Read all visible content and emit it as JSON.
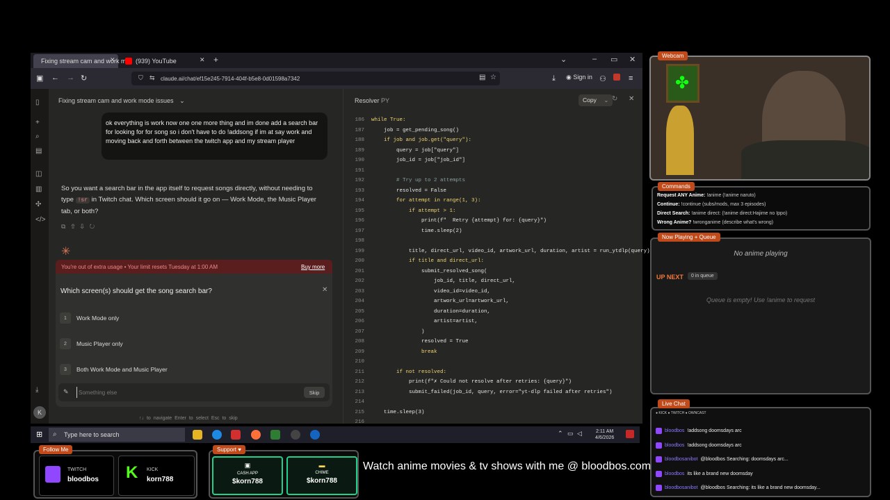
{
  "browser": {
    "tabs": [
      {
        "label": "Fixing stream cam and work m"
      },
      {
        "label": "(939) YouTube"
      }
    ],
    "url": "claude.ai/chat/ef15e245-7914-404f-b5e8-0d01598a7342",
    "signin_label": "Sign in"
  },
  "chat": {
    "title": "Fixing stream cam and work mode issues",
    "user_message": "ok everything is work now one one more thing and im done add a search bar for looking for for song so i don't have to do !addsong if im at say work and moving back and forth between the twitch app and my stream player",
    "assistant_pre": "So you want a search bar in the app itself to request songs directly, without needing to type",
    "assistant_code": "!sr",
    "assistant_post": "in Twitch chat. Which screen should it go on — Work Mode, the Music Player tab, or both?",
    "limit_text": "You're out of extra usage • Your limit resets Tuesday at 1:00 AM",
    "buy_more": "Buy more",
    "question": "Which screen(s) should get the song search bar?",
    "options": [
      {
        "num": "1",
        "label": "Work Mode only"
      },
      {
        "num": "2",
        "label": "Music Player only"
      },
      {
        "num": "3",
        "label": "Both Work Mode and Music Player"
      }
    ],
    "other_placeholder": "Something else",
    "skip": "Skip",
    "hints": "↑↓ to navigate   Enter to select   Esc to skip"
  },
  "code": {
    "title": "Resolver",
    "lang": "PY",
    "copy": "Copy",
    "lines": [
      {
        "n": "186",
        "t": "while True:"
      },
      {
        "n": "187",
        "t": "    job = get_pending_song()"
      },
      {
        "n": "188",
        "t": "    if job and job.get(\"query\"):"
      },
      {
        "n": "189",
        "t": "        query = job[\"query\"]"
      },
      {
        "n": "190",
        "t": "        job_id = job[\"job_id\"]"
      },
      {
        "n": "191",
        "t": ""
      },
      {
        "n": "192",
        "t": "        # Try up to 2 attempts"
      },
      {
        "n": "193",
        "t": "        resolved = False"
      },
      {
        "n": "194",
        "t": "        for attempt in range(1, 3):"
      },
      {
        "n": "195",
        "t": "            if attempt > 1:"
      },
      {
        "n": "196",
        "t": "                print(f\"  Retry {attempt} for: {query}\")"
      },
      {
        "n": "197",
        "t": "                time.sleep(2)"
      },
      {
        "n": "198",
        "t": ""
      },
      {
        "n": "199",
        "t": "            title, direct_url, video_id, artwork_url, duration, artist = run_ytdlp(query)"
      },
      {
        "n": "200",
        "t": "            if title and direct_url:"
      },
      {
        "n": "201",
        "t": "                submit_resolved_song("
      },
      {
        "n": "202",
        "t": "                    job_id, title, direct_url,"
      },
      {
        "n": "203",
        "t": "                    video_id=video_id,"
      },
      {
        "n": "204",
        "t": "                    artwork_url=artwork_url,"
      },
      {
        "n": "205",
        "t": "                    duration=duration,"
      },
      {
        "n": "206",
        "t": "                    artist=artist,"
      },
      {
        "n": "207",
        "t": "                )"
      },
      {
        "n": "208",
        "t": "                resolved = True"
      },
      {
        "n": "209",
        "t": "                break"
      },
      {
        "n": "210",
        "t": ""
      },
      {
        "n": "211",
        "t": "        if not resolved:"
      },
      {
        "n": "212",
        "t": "            print(f\"✗ Could not resolve after retries: {query}\")"
      },
      {
        "n": "213",
        "t": "            submit_failed(job_id, query, error=\"yt-dlp failed after retries\")"
      },
      {
        "n": "214",
        "t": ""
      },
      {
        "n": "215",
        "t": "    time.sleep(3)"
      },
      {
        "n": "216",
        "t": ""
      }
    ]
  },
  "taskbar": {
    "search_placeholder": "Type here to search",
    "time": "2:11 AM",
    "date": "4/6/2026"
  },
  "overlay": {
    "webcam_tag": "Webcam",
    "commands_tag": "Commands",
    "commands": [
      {
        "label": "Request ANY Anime:",
        "cmd": "!anime",
        "desc": "(!anime naruto)"
      },
      {
        "label": "Continue:",
        "cmd": "!continue",
        "desc": "(subs/mods, max 3 episodes)"
      },
      {
        "label": "Direct Search:",
        "cmd": "!anime direct:",
        "desc": "(!anime direct:Hajime no Ippo)"
      },
      {
        "label": "Wrong Anime?",
        "cmd": "!wronganime",
        "desc": "(describe what's wrong)"
      }
    ],
    "now_playing_tag": "Now Playing + Queue",
    "no_anime": "No anime playing",
    "up_next": "UP NEXT",
    "queue_count": "0 in queue",
    "queue_empty": "Queue is empty! Use !anime to request",
    "live_chat_tag": "Live Chat",
    "platforms": "● KICK  ● TWITCH  ● OWNCAST",
    "chat": [
      {
        "user": "bloodbos",
        "msg": "!addsong doomsdays arc"
      },
      {
        "user": "bloodbos",
        "msg": "!addsong doomsdays arc"
      },
      {
        "user": "bloodbosanibot",
        "msg": "@bloodbos Searching: doomsdays arc..."
      },
      {
        "user": "bloodbos",
        "msg": "its like a brand new doomsday"
      },
      {
        "user": "bloodbosanibot",
        "msg": "@bloodbos Searching: its like a brand new doomsday..."
      }
    ],
    "follow_tag": "Follow Me",
    "twitch_label": "TWITCH",
    "twitch_user": "bloodbos",
    "kick_label": "KICK",
    "kick_user": "korn788",
    "support_tag": "Support ♥",
    "cashapp_label": "CASH APP",
    "cashapp_user": "$korn788",
    "chime_label": "CHIME",
    "chime_user": "$korn788",
    "watch_text": "Watch anime movies & tv shows with me @ bloodbos.com"
  },
  "colors": {
    "accent_orange": "#d97757",
    "kick_green": "#53fc18",
    "twitch_purple": "#9146ff",
    "money_green": "#1fd18a"
  }
}
